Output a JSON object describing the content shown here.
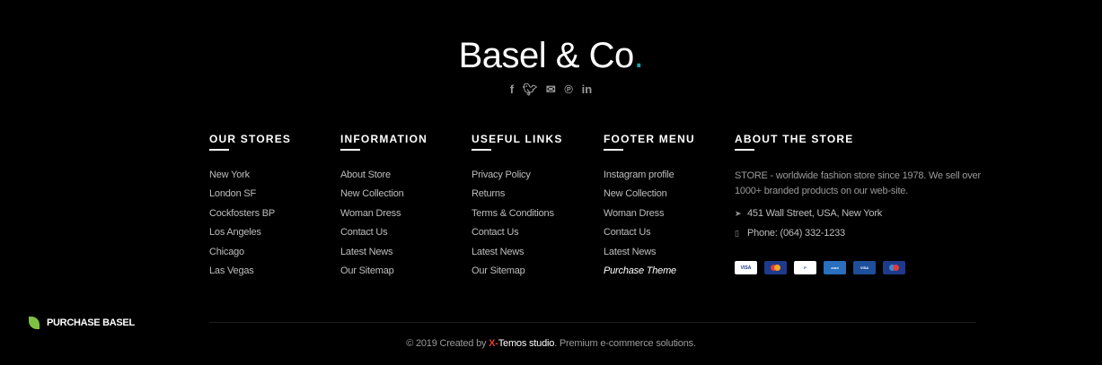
{
  "logo": {
    "text": "Basel & Co",
    "dot": "."
  },
  "social": [
    "facebook-icon",
    "twitter-icon",
    "email-icon",
    "pinterest-icon",
    "linkedin-icon"
  ],
  "columns": [
    {
      "title": "OUR STORES",
      "items": [
        "New York",
        "London SF",
        "Cockfosters BP",
        "Los Angeles",
        "Chicago",
        "Las Vegas"
      ]
    },
    {
      "title": "INFORMATION",
      "items": [
        "About Store",
        "New Collection",
        "Woman Dress",
        "Contact Us",
        "Latest News",
        "Our Sitemap"
      ]
    },
    {
      "title": "USEFUL LINKS",
      "items": [
        "Privacy Policy",
        "Returns",
        "Terms & Conditions",
        "Contact Us",
        "Latest News",
        "Our Sitemap"
      ]
    },
    {
      "title": "FOOTER MENU",
      "items": [
        "Instagram profile",
        "New Collection",
        "Woman Dress",
        "Contact Us",
        "Latest News",
        "Purchase Theme"
      ]
    }
  ],
  "about": {
    "title": "ABOUT THE STORE",
    "text": "STORE - worldwide fashion store since 1978. We sell over 1000+ branded products on our web-site.",
    "address": "451 Wall Street, USA, New York",
    "phone": "Phone: (064) 332-1233"
  },
  "payments": [
    "VISA",
    "mastercard",
    "PayPal",
    "AMERICAN EXPRESS",
    "VISA Electron",
    "Maestro"
  ],
  "copyright": {
    "prefix": "© 2019 Created by ",
    "x": "X-",
    "studio": "Temos studio",
    "suffix": ". Premium e-commerce solutions."
  },
  "purchase_label": "PURCHASE BASEL",
  "colors": {
    "accent": "#1aa6a6",
    "background": "#000000",
    "leaf": "#7fc142"
  }
}
